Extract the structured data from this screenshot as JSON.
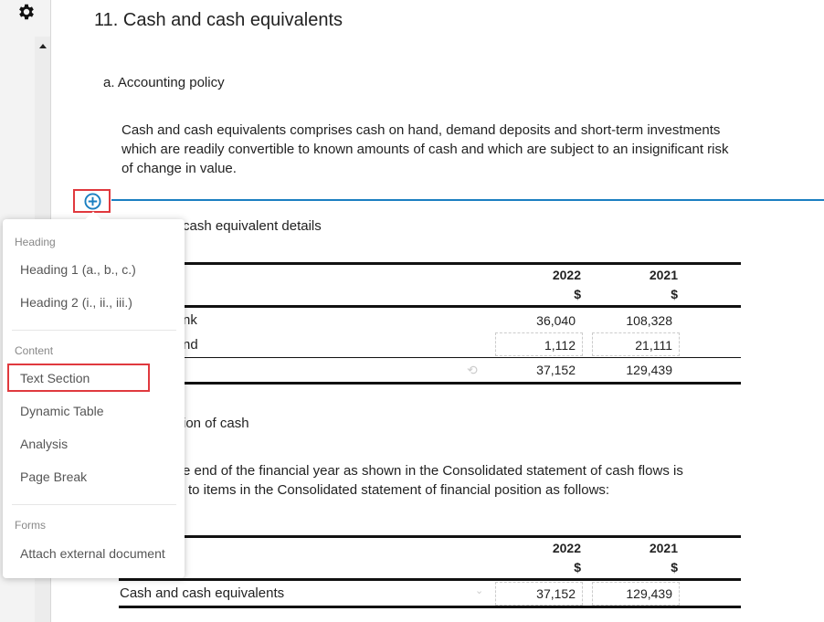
{
  "sidebar": {
    "settings_icon": "gear-icon",
    "scroll_up_icon": "triangle-up-icon"
  },
  "document": {
    "title": "11. Cash and cash equivalents",
    "subheading_a": "a. Accounting policy",
    "policy_text": [
      "Cash and cash equivalents comprises cash on hand, demand deposits and short-term investments",
      "which are readily convertible to known amounts of cash and which are subject to an insignificant risk",
      "of change in value."
    ],
    "add_icon": "plus-circle-icon",
    "subheading_b": "cash equivalent details",
    "table1": {
      "headers": [
        "2022",
        "2021"
      ],
      "units": [
        "$",
        "$"
      ],
      "rows": [
        {
          "label": "nk",
          "values": [
            "36,040",
            "108,328"
          ]
        },
        {
          "label": "nd",
          "values": [
            "1,112",
            "21,111"
          ]
        }
      ],
      "total": [
        "37,152",
        "129,439"
      ],
      "reset_icon": "undo-icon"
    },
    "subheading_c": "ion of cash",
    "recon_text": [
      "e end of the financial year as shown in the Consolidated statement of cash flows is",
      "to items in the Consolidated statement of financial position as follows:"
    ],
    "table2": {
      "headers": [
        "2022",
        "2021"
      ],
      "units": [
        "$",
        "$"
      ],
      "rows": [
        {
          "label": "Cash and cash equivalents",
          "values": [
            "37,152",
            "129,439"
          ]
        }
      ],
      "dropdown_icon": "chevron-down-icon"
    }
  },
  "menu": {
    "sections": [
      {
        "label": "Heading",
        "items": [
          "Heading 1 (a., b., c.)",
          "Heading 2 (i., ii., iii.)"
        ]
      },
      {
        "label": "Content",
        "items": [
          "Text Section",
          "Dynamic Table",
          "Analysis",
          "Page Break"
        ]
      },
      {
        "label": "Forms",
        "items": [
          "Attach external document"
        ]
      }
    ],
    "highlighted": "Text Section"
  },
  "colors": {
    "accent": "#1a7fc1",
    "highlight": "#e0393e"
  }
}
